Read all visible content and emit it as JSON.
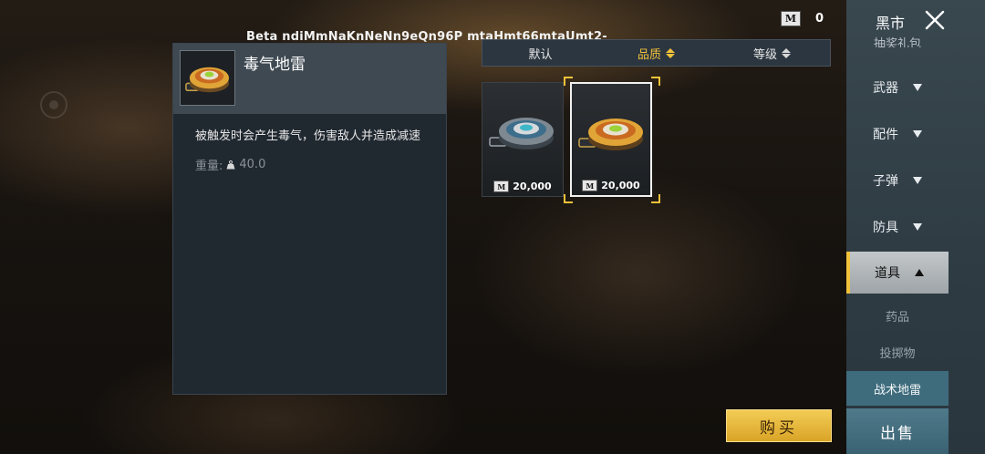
{
  "watermark": "Beta ndiMmNaKnNeNn9eQn96P mtaHmt66mtaUmt2-",
  "currency": {
    "icon": "m-coin-icon",
    "badge": "M",
    "value": "0"
  },
  "detail": {
    "title": "毒气地雷",
    "description": "被触发时会产生毒气，伤害敌人并造成减速",
    "weight_label": "重量:",
    "weight_value": "40.0"
  },
  "sort_bar": [
    {
      "label": "默认",
      "active": false,
      "arrows": false
    },
    {
      "label": "品质",
      "active": true,
      "arrows": true
    },
    {
      "label": "等级",
      "active": false,
      "arrows": true
    }
  ],
  "items": [
    {
      "name": "mine-blue",
      "price": "20,000",
      "selected": false,
      "accent": "#3fb7c9"
    },
    {
      "name": "mine-orange",
      "price": "20,000",
      "selected": true,
      "accent": "#9ad23a"
    }
  ],
  "buy_button": "购买",
  "sidebar": {
    "title": "黑市",
    "cut_label": "抽奖礼包",
    "categories": [
      {
        "label": "武器",
        "expanded": false
      },
      {
        "label": "配件",
        "expanded": false
      },
      {
        "label": "子弹",
        "expanded": false
      },
      {
        "label": "防具",
        "expanded": false
      },
      {
        "label": "道具",
        "expanded": true
      }
    ],
    "subcategories": [
      {
        "label": "药品",
        "selected": false
      },
      {
        "label": "投掷物",
        "selected": false
      },
      {
        "label": "战术地雷",
        "selected": true
      }
    ],
    "sell_button": "出售"
  },
  "colors": {
    "gold": "#f1c23a",
    "panel": "#202830",
    "sidebar": "#39474f",
    "selected_sub": "#3f6c7d"
  }
}
